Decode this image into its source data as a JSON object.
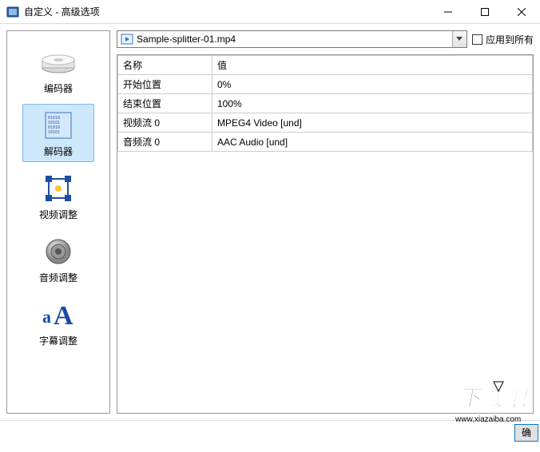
{
  "window": {
    "title": "自定义 - 高级选项"
  },
  "sidebar": {
    "items": [
      {
        "label": "编码器"
      },
      {
        "label": "解码器"
      },
      {
        "label": "视频调整"
      },
      {
        "label": "音频调整"
      },
      {
        "label": "字幕调整"
      }
    ],
    "selected_index": 1
  },
  "file_dropdown": {
    "selected": "Sample-splitter-01.mp4"
  },
  "apply_all": {
    "label": "应用到所有",
    "checked": false
  },
  "table": {
    "headers": {
      "name": "名称",
      "value": "值"
    },
    "rows": [
      {
        "name": "开始位置",
        "value": "0%"
      },
      {
        "name": "结束位置",
        "value": "100%"
      },
      {
        "name": "视频流 0",
        "value": "MPEG4 Video [und]"
      },
      {
        "name": "音频流 0",
        "value": "AAC Audio [und]"
      }
    ]
  },
  "footer": {
    "ok_partial": "确"
  },
  "watermark": {
    "line1": "下载吧",
    "line2": "www.xiazaiba.com"
  }
}
